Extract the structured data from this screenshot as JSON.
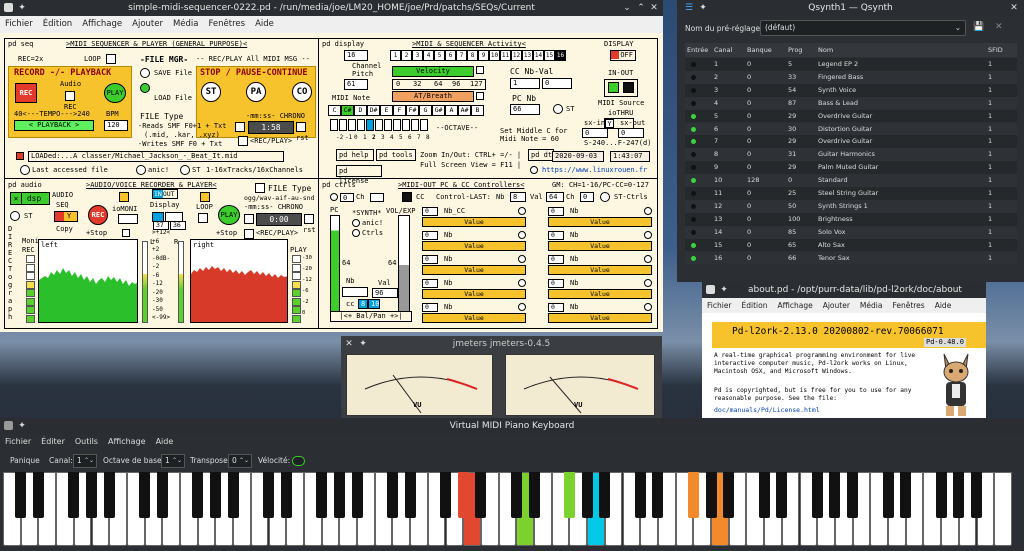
{
  "pd_window": {
    "title": "simple-midi-sequencer-0222.pd - /run/media/joe/LM20_HOME/joe/Prd/patchs/SEQs/Current",
    "menu": [
      "Fichier",
      "Édition",
      "Affichage",
      "Ajouter",
      "Média",
      "Fenêtres",
      "Aide"
    ],
    "seq": {
      "label": "pd seq",
      "header": ">MIDI SEQUENCER & PLAYER (GENERAL PURPOSE)<",
      "rec": "REC=2x",
      "loop": "LOOP",
      "file_mgr": "-FILE MGR-",
      "rec_play": "-- REC/PLAY All MIDI MSG --",
      "record_playback": "RECORD -/- PLAYBACK",
      "audio": "Audio",
      "rec_btn": "REC",
      "play_btn": "PLAY",
      "rec_small": "REC",
      "save_file": "SAVE File",
      "load_file": "LOAD File",
      "stop_pause": "STOP / PAUSE-CONTINUE",
      "st": "ST",
      "pa": "PA",
      "co": "CO",
      "tempo": "40<---TEMPO--->240",
      "bpm": "BPM",
      "playback": "< PLAYBACK >",
      "bpm_val": "120",
      "file_type": "FILE Type",
      "file_desc": [
        "-Reads SMF F0+1 + Txt",
        "(.mid, .kar, .xyz)",
        "-Writes SMF F0 + Txt"
      ],
      "chrono": "-mm:ss- CHRONO",
      "chrono_val": "1:58",
      "rst": "rst",
      "rec_play_small": "<REC/PLAY>",
      "loaded": "LOADed:...A classer/Michael_Jackson_-_Beat_It.mid",
      "last_file": "Last accessed file",
      "panic": "anic!",
      "st2": "ST",
      "tracks": "1-16xTracks/16xChannels"
    },
    "display": {
      "label": "pd display",
      "header": ">MIDI & SEQUENCER Activity<",
      "display": "DISPLAY",
      "off": "OFF",
      "channel_val": "16",
      "channel_nums": [
        "1",
        "2",
        "3",
        "4",
        "5",
        "6",
        "7",
        "8",
        "9",
        "10",
        "11",
        "12",
        "13",
        "14",
        "15",
        "16"
      ],
      "channel_label": "Channel",
      "pitch_label": "Pitch",
      "pitch_val": "61",
      "pitch_scale": [
        "0",
        "32",
        "64",
        "96",
        "127"
      ],
      "velocity": "Velocity",
      "at_breath": "AT/Breath",
      "cc_nb_val": "CC Nb-Val",
      "cc_a": "1",
      "cc_b": "0",
      "in_out": "IN-OUT",
      "midi_note": "MIDI Note",
      "notes": [
        "C",
        "C#",
        "D",
        "D#",
        "E",
        "F",
        "F#",
        "G",
        "G#",
        "A",
        "A#",
        "B"
      ],
      "pc_nb": "PC Nb",
      "pc_val": "66",
      "st": "ST",
      "midi_source": "MIDI Source",
      "iothru": "ioTHRU",
      "y": "Y",
      "octave": "--OCTAVE--",
      "octaves": [
        "-2",
        "-1",
        "0",
        "1",
        "2",
        "3",
        "4",
        "5",
        "6",
        "7",
        "8"
      ],
      "set_middle": "Set Middle C for",
      "midi_note_60": "Midi Note = 60",
      "sx_in": "sx-in",
      "sx_out": "sx-out",
      "sx_a": "0",
      "sx_b": "0",
      "sx_range": "S-240...F-247(d)",
      "pd_help": "pd help",
      "pd_tools": "pd tools",
      "zoom": "Zoom In/Out: CTRL+ =/- |",
      "full": "Full Screen View = F11 |",
      "pd_license": "pd license",
      "url": "https://www.linuxrouen.fr",
      "pd_dt": "pd dt",
      "date": "2020-09-03",
      "time": "1:43:07"
    },
    "audio": {
      "label": "pd audio",
      "header": ">AUDIO/VOICE RECORDER & PLAYER<",
      "dsp": "dsp",
      "audio": "AUDIO",
      "seq": "SEQ",
      "st": "ST",
      "y": "Y",
      "rec": "REC",
      "copy": "Copy",
      "stop": "+Stop",
      "iomoni": "ioMONI",
      "display": "Display",
      "in": "IN",
      "out": "OUT",
      "loop": "LOOP",
      "play": "PLAY",
      "file_type": "FILE Type",
      "ogg": "ogg/wav-aif-au-snd",
      "chrono": "-mm:ss- CHRONO",
      "chrono_val": "0:00",
      "rst": "rst",
      "rec_play": "<REC/PLAY>",
      "direct": [
        "D",
        "I",
        "R",
        "E",
        "C",
        "T",
        "o",
        "g",
        "r",
        "a",
        "p",
        "h"
      ],
      "moni": "Moni",
      "rec_label": "REC",
      "left": "left",
      "right": "right",
      "play_label": "PLAY",
      "db_scale": [
        ">+12<",
        "+6",
        "+2",
        "-0dB-",
        "-2",
        "-6",
        "-12",
        "-20",
        "-30",
        "-50",
        "<-99>"
      ],
      "l": "L",
      "r": "R",
      "db_left": "37",
      "db_right": "36",
      "play_scale": [
        "-30",
        "-20",
        "-12",
        "-6",
        "-2",
        "0"
      ]
    },
    "ctrls": {
      "label": "pd ctrls",
      "header": ">MIDI-OUT PC & CC Controllers<",
      "gm": "GM: CH=1-16/PC-CC=0-127",
      "ch": "Ch",
      "ch_val": "0",
      "cc": "CC",
      "control_last": "Control-LAST:",
      "nb": "Nb",
      "nb_val": "8",
      "val": "Val",
      "val_val": "64",
      "ch2": "Ch",
      "ch2_val": "0",
      "st_ctrls": "ST-Ctrls",
      "pc": "PC",
      "synth": "*SYNTH*",
      "vol_exp": "VOL/EXP",
      "anic": "anic!",
      "ctrls": "Ctrls",
      "n64a": "64",
      "n64b": "64",
      "nb2": "Nb",
      "val2": "Val",
      "val96": "96",
      "cc_label": "cc",
      "cc8": "8",
      "cc10": "10",
      "bal_pan": "|<+ Bal/Pan +>|",
      "cc_rows": [
        {
          "a": "0",
          "b": "Nb_CC",
          "c": "0",
          "d": "Nb",
          "value": "Value"
        },
        {
          "a": "0",
          "b": "Nb",
          "c": "0",
          "d": "Nb",
          "value": "Value"
        },
        {
          "a": "0",
          "b": "Nb",
          "c": "0",
          "d": "Nb",
          "value": "Value"
        },
        {
          "a": "0",
          "b": "Nb",
          "c": "0",
          "d": "Nb",
          "value": "Value"
        },
        {
          "a": "0",
          "b": "Nb",
          "c": "0",
          "d": "Nb",
          "value": "Value"
        }
      ]
    }
  },
  "qsynth": {
    "title": "Qsynth1 — Qsynth",
    "preset_label": "Nom du pré-réglage :",
    "preset_value": "(défaut)",
    "columns": [
      "Entrée",
      "Canal",
      "Banque",
      "Prog",
      "Nom",
      "SFID"
    ],
    "rows": [
      {
        "on": false,
        "ch": "1",
        "bank": "0",
        "prog": "5",
        "name": "Legend EP 2",
        "sfid": "1"
      },
      {
        "on": false,
        "ch": "2",
        "bank": "0",
        "prog": "33",
        "name": "Fingered Bass",
        "sfid": "1"
      },
      {
        "on": false,
        "ch": "3",
        "bank": "0",
        "prog": "54",
        "name": "Synth Voice",
        "sfid": "1"
      },
      {
        "on": false,
        "ch": "4",
        "bank": "0",
        "prog": "87",
        "name": "Bass & Lead",
        "sfid": "1"
      },
      {
        "on": true,
        "ch": "5",
        "bank": "0",
        "prog": "29",
        "name": "Overdrive Guitar",
        "sfid": "1"
      },
      {
        "on": true,
        "ch": "6",
        "bank": "0",
        "prog": "30",
        "name": "Distortion Guitar",
        "sfid": "1"
      },
      {
        "on": true,
        "ch": "7",
        "bank": "0",
        "prog": "29",
        "name": "Overdrive Guitar",
        "sfid": "1"
      },
      {
        "on": false,
        "ch": "8",
        "bank": "0",
        "prog": "31",
        "name": "Guitar Harmonics",
        "sfid": "1"
      },
      {
        "on": false,
        "ch": "9",
        "bank": "0",
        "prog": "29",
        "name": "Palm Muted Guitar",
        "sfid": "1"
      },
      {
        "on": true,
        "ch": "10",
        "bank": "128",
        "prog": "0",
        "name": "Standard",
        "sfid": "1"
      },
      {
        "on": false,
        "ch": "11",
        "bank": "0",
        "prog": "25",
        "name": "Steel String Guitar",
        "sfid": "1"
      },
      {
        "on": false,
        "ch": "12",
        "bank": "0",
        "prog": "50",
        "name": "Synth Strings 1",
        "sfid": "1"
      },
      {
        "on": false,
        "ch": "13",
        "bank": "0",
        "prog": "100",
        "name": "Brightness",
        "sfid": "1"
      },
      {
        "on": false,
        "ch": "14",
        "bank": "0",
        "prog": "85",
        "name": "Solo Vox",
        "sfid": "1"
      },
      {
        "on": true,
        "ch": "15",
        "bank": "0",
        "prog": "65",
        "name": "Alto Sax",
        "sfid": "1"
      },
      {
        "on": true,
        "ch": "16",
        "bank": "0",
        "prog": "66",
        "name": "Tenor Sax",
        "sfid": "1"
      }
    ]
  },
  "about": {
    "title": "about.pd - /opt/purr-data/lib/pd-l2ork/doc/about",
    "menu": [
      "Fichier",
      "Édition",
      "Affichage",
      "Ajouter",
      "Média",
      "Fenêtres",
      "Aide"
    ],
    "heading": "Pd-l2ork-2.13.0 20200802-rev.70066071",
    "version": "Pd-0.48.0",
    "para1": "A real-time graphical programming environment for live interactive computer music, Pd-l2ork works on Linux, Macintosh OSX, and Microsoft Windows.",
    "para2": "Pd is copyrighted, but is free for you to use for any reasonable purpose. See the file:",
    "link": "doc/manuals/Pd/License.html"
  },
  "jmeters": {
    "title": "jmeters jmeters-0.4.5",
    "vu": "VU",
    "scale": [
      "-20",
      "-10",
      "-7",
      "-5",
      "-3",
      "-1",
      "0",
      "+1",
      "+2",
      "+3"
    ]
  },
  "vmpk": {
    "title": "Virtual MIDI Piano Keyboard",
    "menu": [
      "Fichier",
      "Éditer",
      "Outils",
      "Affichage",
      "Aide"
    ],
    "panic": "Panique",
    "channel_label": "Canal:",
    "channel_val": "1",
    "octave_label": "Octave de base:",
    "octave_val": "1",
    "transpose_label": "Transposer:",
    "transpose_val": "0",
    "velocity_label": "Vélocité:"
  },
  "colors": {
    "accent_yellow": "#f6c32c",
    "active_green": "#3ccd2d",
    "rec_red": "#e23b2b",
    "cyan_key": "#00c8e6",
    "orange_key": "#f08a2a"
  }
}
